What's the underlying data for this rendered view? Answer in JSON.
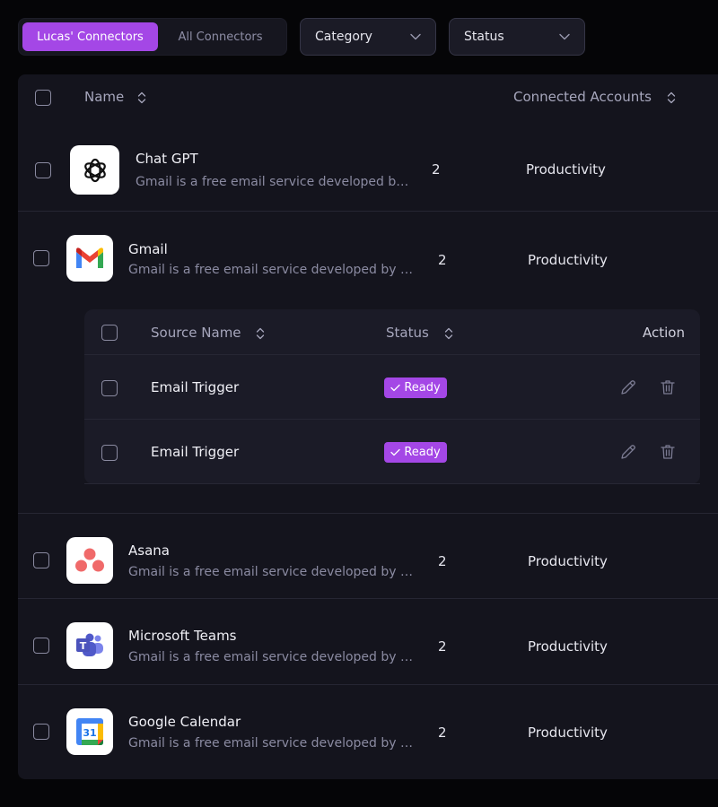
{
  "toolbar": {
    "tabs": [
      {
        "label": "Lucas' Connectors",
        "active": true
      },
      {
        "label": "All Connectors",
        "active": false
      }
    ],
    "filters": [
      {
        "label": "Category"
      },
      {
        "label": "Status"
      }
    ]
  },
  "table": {
    "headers": {
      "name": "Name",
      "connected_accounts": "Connected Accounts"
    },
    "rows": [
      {
        "title": "Chat GPT",
        "description": "Gmail is a free email service developed by Google",
        "count": "2",
        "category": "Productivity",
        "icon": "chatgpt-logo-icon"
      },
      {
        "title": "Gmail",
        "description": "Gmail is a free email service developed by Google",
        "count": "2",
        "category": "Productivity",
        "icon": "gmail-logo-icon"
      },
      {
        "title": "Asana",
        "description": "Gmail is a free email service developed by Google",
        "count": "2",
        "category": "Productivity",
        "icon": "asana-logo-icon"
      },
      {
        "title": "Microsoft Teams",
        "description": "Gmail is a free email service developed by Google",
        "count": "2",
        "category": "Productivity",
        "icon": "teams-logo-icon"
      },
      {
        "title": "Google Calendar",
        "description": "Gmail is a free email service developed by Google",
        "count": "2",
        "category": "Productivity",
        "icon": "google-calendar-logo-icon"
      }
    ]
  },
  "sources": {
    "headers": {
      "name": "Source Name",
      "status": "Status",
      "action": "Action"
    },
    "rows": [
      {
        "name": "Email Trigger",
        "status": "Ready"
      },
      {
        "name": "Email Trigger",
        "status": "Ready"
      }
    ]
  },
  "calendar_logo_text": "31",
  "colors": {
    "accent": "#a447e6",
    "panel": "#14141d",
    "subpanel": "#1b1b27"
  }
}
